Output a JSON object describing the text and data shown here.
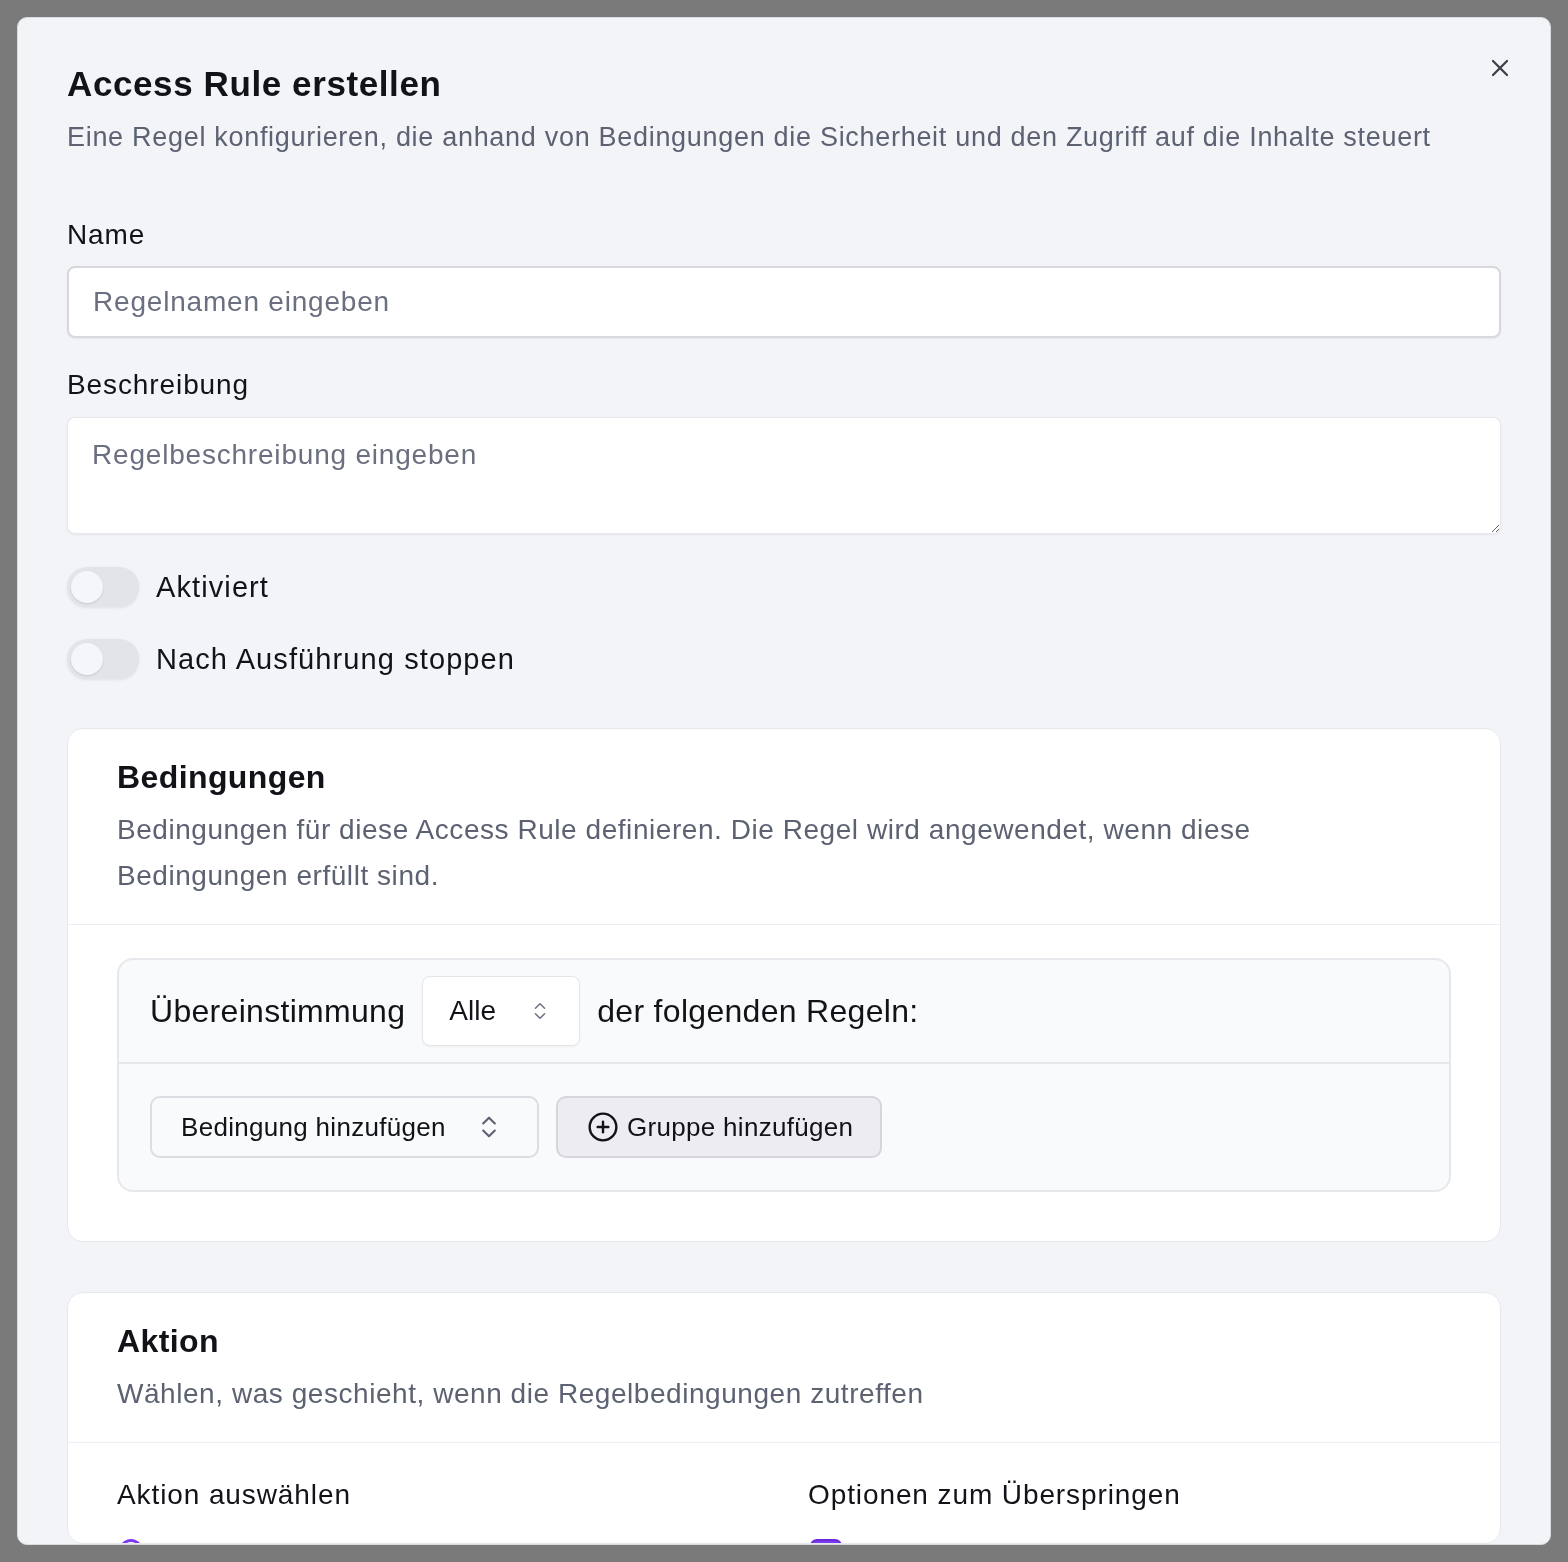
{
  "dialog": {
    "title": "Access Rule erstellen",
    "subtitle": "Eine Regel konfigurieren, die anhand von Bedingungen die Sicherheit und den Zugriff auf die Inhalte steuert"
  },
  "fields": [
    {
      "kind": "input",
      "label": "Name",
      "placeholder": "Regelnamen eingeben"
    },
    {
      "kind": "textarea",
      "label": "Beschreibung",
      "placeholder": "Regelbeschreibung eingeben"
    }
  ],
  "toggles": [
    {
      "label": "Aktiviert",
      "on": false
    },
    {
      "label": "Nach Ausführung stoppen",
      "on": false
    }
  ],
  "conditions": {
    "title": "Bedingungen",
    "description": "Bedingungen für diese Access Rule definieren. Die Regel wird angewendet, wenn diese Bedingungen erfüllt sind.",
    "match": {
      "prefix": "Übereinstimmung",
      "value": "Alle",
      "suffix": "der folgenden Regeln:"
    },
    "add_condition": {
      "label": "Bedingung hinzufügen"
    },
    "add_group": {
      "label": "Gruppe hinzufügen"
    }
  },
  "action": {
    "title": "Aktion",
    "description": "Wählen, was geschieht, wenn die Regelbedingungen zutreffen",
    "columns": [
      {
        "heading": "Aktion auswählen",
        "options": [
          {
            "kind": "radio",
            "selected": true
          }
        ]
      },
      {
        "heading": "Optionen zum Überspringen",
        "options": [
          {
            "kind": "checkbox",
            "checked": true
          }
        ]
      }
    ]
  }
}
